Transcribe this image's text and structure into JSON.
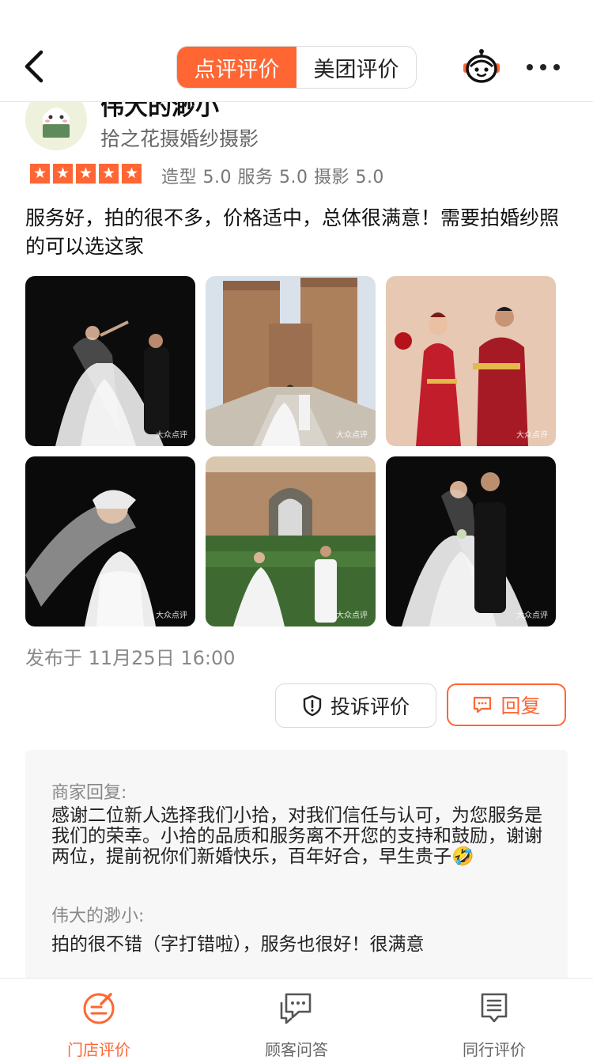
{
  "colors": {
    "accent": "#ff6633",
    "text": "#222222",
    "muted": "#888888",
    "reply_bg": "#f7f7f7"
  },
  "header": {
    "back_icon": "chevron-left-icon",
    "tabs": [
      {
        "label": "点评评价",
        "active": true
      },
      {
        "label": "美团评价",
        "active": false
      }
    ],
    "assistant_icon": "robot-assistant-icon",
    "more_icon": "more-dots-icon"
  },
  "review": {
    "user_name": "伟大的渺小",
    "shop_name": "拾之花摄婚纱摄影",
    "rating_stars": 5,
    "scores": "造型 5.0 服务 5.0 摄影 5.0",
    "text": "服务好，拍的很不多，价格适中，总体很满意！需要拍婚纱照的可以选这家",
    "photo_watermark": "大众点评",
    "posted": "发布于 11月25日 16:00"
  },
  "actions": {
    "report_label": "投诉评价",
    "reply_label": "回复"
  },
  "merchant_reply": {
    "label": "商家回复:",
    "text": "感谢二位新人选择我们小拾，对我们信任与认可，为您服务是我们的荣幸。小拾的品质和服务离不开您的支持和鼓励，谢谢两位，提前祝你们新婚快乐，百年好合，早生贵子🤣",
    "user_label": "伟大的渺小:",
    "user_text": "拍的很不错（字打错啦），服务也很好！很满意"
  },
  "tabbar": {
    "items": [
      {
        "label": "门店评价",
        "icon": "edit-circle-icon",
        "active": true
      },
      {
        "label": "顾客问答",
        "icon": "chat-bubbles-icon",
        "active": false
      },
      {
        "label": "同行评价",
        "icon": "list-document-icon",
        "active": false
      }
    ]
  }
}
